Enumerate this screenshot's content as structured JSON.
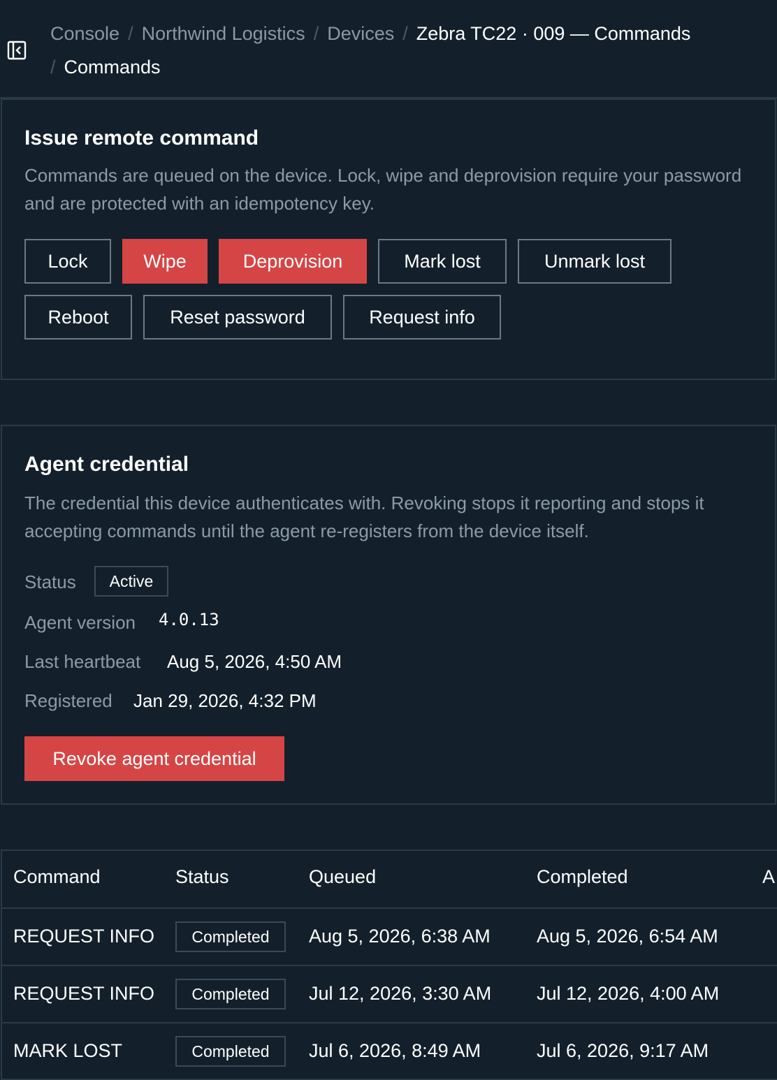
{
  "breadcrumb": {
    "items": [
      "Console",
      "Northwind Logistics",
      "Devices",
      "Zebra TC22 · 009 — Commands",
      "Commands"
    ]
  },
  "commands_panel": {
    "title": "Issue remote command",
    "description": "Commands are queued on the device. Lock, wipe and deprovision require your password and are protected with an idempotency key.",
    "buttons": {
      "lock": "Lock",
      "wipe": "Wipe",
      "deprovision": "Deprovision",
      "mark_lost": "Mark lost",
      "unmark_lost": "Unmark lost",
      "reboot": "Reboot",
      "reset_password": "Reset password",
      "request_info": "Request info"
    }
  },
  "credential_panel": {
    "title": "Agent credential",
    "description": "The credential this device authenticates with. Revoking stops it reporting and stops it accepting commands until the agent re-registers from the device itself.",
    "status_label": "Status",
    "status_value": "Active",
    "version_label": "Agent version",
    "version_value": "4.0.13",
    "heartbeat_label": "Last heartbeat",
    "heartbeat_value": "Aug 5, 2026, 4:50 AM",
    "registered_label": "Registered",
    "registered_value": "Jan 29, 2026, 4:32 PM",
    "revoke_button": "Revoke agent credential"
  },
  "history_table": {
    "headers": [
      "Command",
      "Status",
      "Queued",
      "Completed",
      "A"
    ],
    "rows": [
      {
        "command": "REQUEST INFO",
        "status": "Completed",
        "queued": "Aug 5, 2026, 6:38 AM",
        "completed": "Aug 5, 2026, 6:54 AM"
      },
      {
        "command": "REQUEST INFO",
        "status": "Completed",
        "queued": "Jul 12, 2026, 3:30 AM",
        "completed": "Jul 12, 2026, 4:00 AM"
      },
      {
        "command": "MARK LOST",
        "status": "Completed",
        "queued": "Jul 6, 2026, 8:49 AM",
        "completed": "Jul 6, 2026, 9:17 AM"
      }
    ]
  },
  "colors": {
    "background": "#13202b",
    "border": "#2b3a47",
    "danger": "#d64545",
    "muted_text": "#8c9ba8"
  }
}
